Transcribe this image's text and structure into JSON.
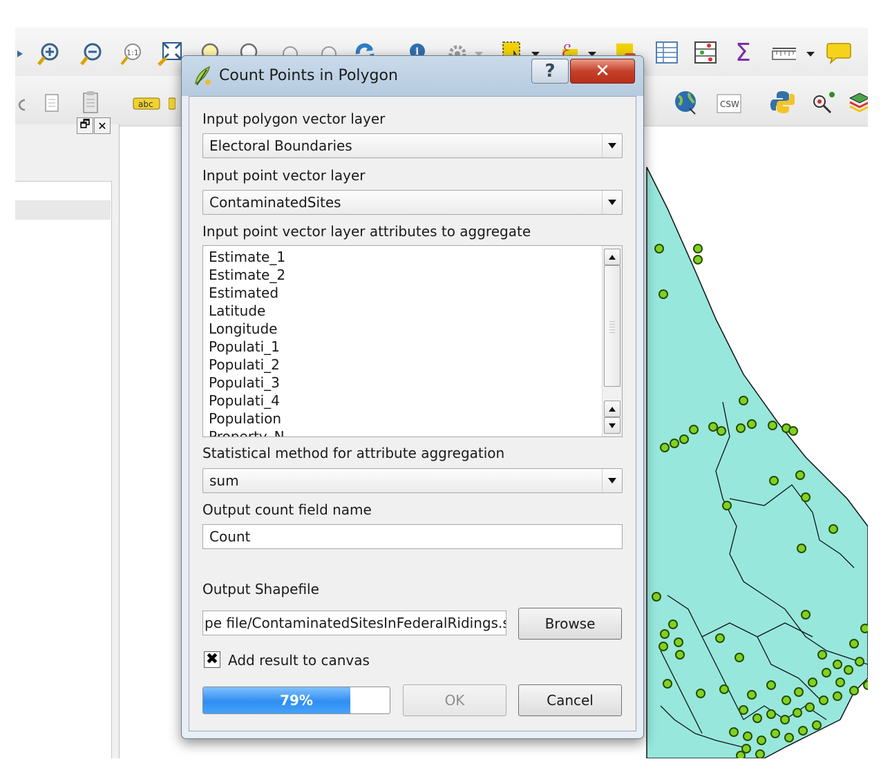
{
  "dialog": {
    "title": "Count Points in Polygon",
    "help_glyph": "?",
    "close_glyph": "✕"
  },
  "form": {
    "polygon_layer": {
      "label": "Input polygon vector layer",
      "value": "Electoral Boundaries"
    },
    "point_layer": {
      "label": "Input point vector layer",
      "value": "ContaminatedSites"
    },
    "attributes": {
      "label": "Input point vector layer attributes to aggregate",
      "items": [
        "Estimate_1",
        "Estimate_2",
        "Estimated",
        "Latitude",
        "Longitude",
        "Populati_1",
        "Populati_2",
        "Populati_3",
        "Populati_4",
        "Population",
        "Property_N"
      ]
    },
    "stat_method": {
      "label": "Statistical method for attribute aggregation",
      "value": "sum"
    },
    "count_field": {
      "label": "Output count field name",
      "value": "Count"
    },
    "output_shapefile": {
      "label": "Output Shapefile",
      "value": "pe file/ContaminatedSitesInFederalRidings.shp"
    },
    "browse_label": "Browse",
    "add_to_canvas": {
      "label": "Add result to canvas",
      "checked": true,
      "mark": "✖"
    },
    "progress": {
      "percent": 79,
      "text": "79%"
    },
    "ok_label": "OK",
    "cancel_label": "Cancel"
  },
  "toolbar": {
    "text_tool_label": "abc",
    "csw_label": "CSW",
    "sum_glyph": "Σ",
    "epsilon_glyph": "ℰ"
  },
  "panel": {
    "float_glyph": "🗗",
    "close_glyph": "✕"
  },
  "colors": {
    "map_fill": "#97e7dc",
    "point_fill": "#7ed321",
    "progress_fill": "#2e8ef0",
    "dialog_title": "#c9daea"
  }
}
